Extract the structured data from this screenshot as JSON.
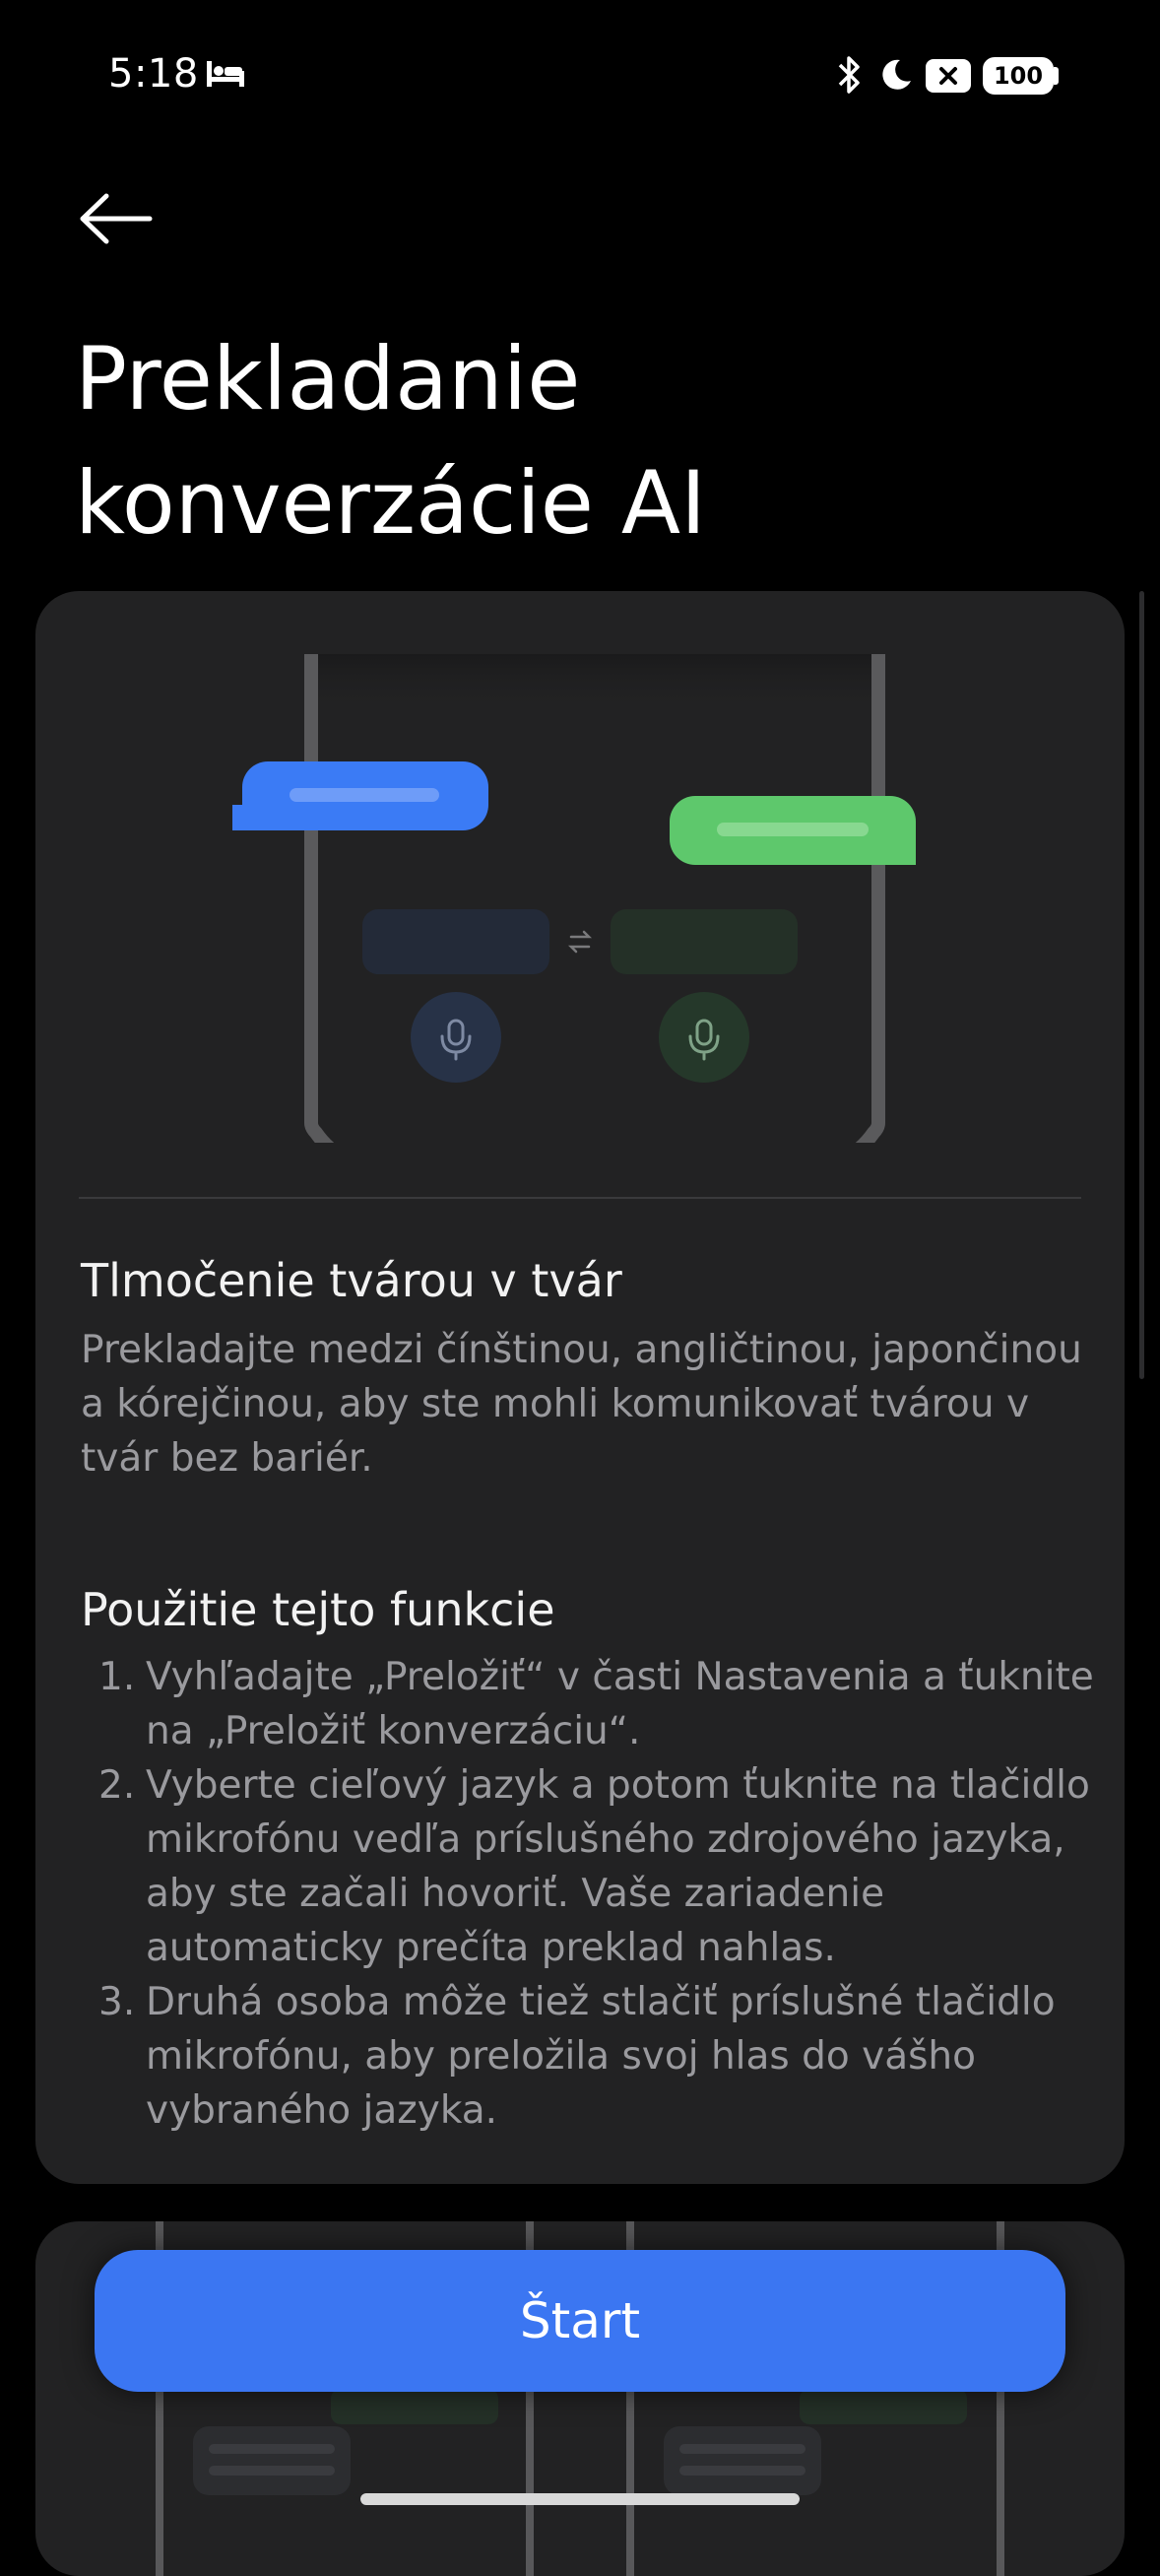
{
  "status_bar": {
    "time": "5:18",
    "icons": [
      "sleep-bed-icon",
      "bluetooth-icon",
      "do-not-disturb-moon-icon",
      "no-sim-icon",
      "battery-icon"
    ],
    "battery_level": "100"
  },
  "header": {
    "back_icon": "arrow-left-icon",
    "title": "Prekladanie konverzácie AI"
  },
  "illustration": {
    "swap_icon": "swap-arrows-icon",
    "mic_icon": "microphone-icon",
    "colors": {
      "bubble_left": "#3b7bf5",
      "bubble_right": "#5ec86c",
      "frame": "#5a5a5c"
    }
  },
  "section1": {
    "title": "Tlmočenie tvárou v tvár",
    "body": "Prekladajte medzi čínštinou, angličtinou, japončinou a kórejčinou, aby ste mohli komunikovať tvárou v tvár bez bariér."
  },
  "section2": {
    "title": "Použitie tejto funkcie",
    "steps": [
      {
        "num": "1.",
        "text": "Vyhľadajte „Preložiť“ v časti Nastavenia a ťuknite na „Preložiť konverzáciu“."
      },
      {
        "num": "2.",
        "text": "Vyberte cieľový jazyk a potom ťuknite na tlačidlo mikrofónu vedľa príslušného zdrojového jazyka, aby ste začali hovoriť.  Vaše zariadenie automaticky prečíta preklad nahlas."
      },
      {
        "num": "3.",
        "text": "Druhá osoba môže tiež stlačiť príslušné tlačidlo mikrofónu, aby preložila svoj hlas do vášho vybraného jazyka."
      }
    ]
  },
  "start_button": {
    "label": "Štart",
    "color": "#3b76f2"
  }
}
